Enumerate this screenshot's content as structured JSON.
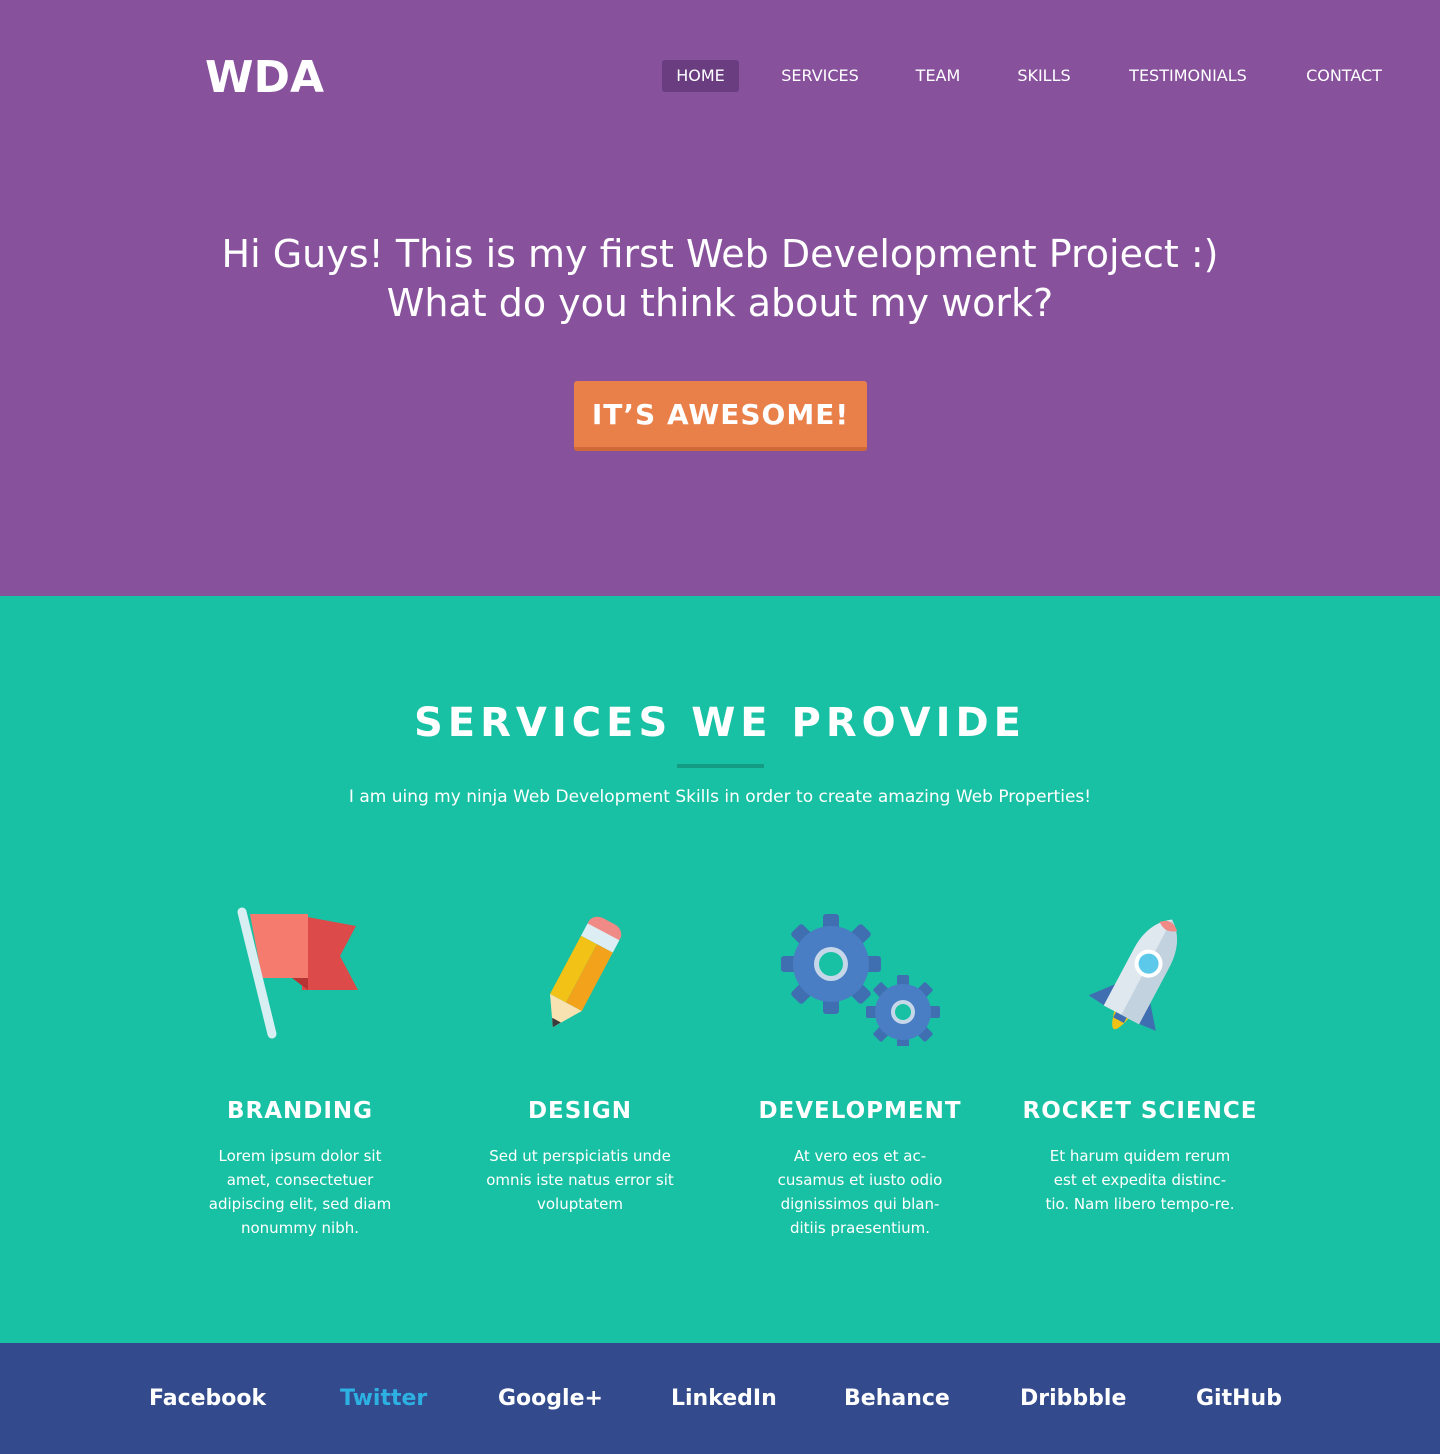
{
  "header": {
    "logo": "WDA",
    "nav": [
      {
        "label": "HOME",
        "active": true
      },
      {
        "label": "SERVICES",
        "active": false
      },
      {
        "label": "TEAM",
        "active": false
      },
      {
        "label": "SKILLS",
        "active": false
      },
      {
        "label": "TESTIMONIALS",
        "active": false
      },
      {
        "label": "CONTACT",
        "active": false
      }
    ]
  },
  "hero": {
    "line1": "Hi Guys! This is my first Web Development Project :)",
    "line2": "What do you think about my work?",
    "cta": "IT’S AWESOME!"
  },
  "services": {
    "title": "SERVICES WE PROVIDE",
    "subtitle": "I am uing my ninja Web Development Skills in order to create amazing Web Properties!",
    "items": [
      {
        "icon": "flag-icon",
        "name": "BRANDING",
        "desc": "Lorem ipsum dolor sit amet, consectetuer adipiscing elit, sed diam nonummy nibh."
      },
      {
        "icon": "pencil-icon",
        "name": "DESIGN",
        "desc": "Sed ut perspiciatis unde omnis iste natus error sit voluptatem"
      },
      {
        "icon": "gears-icon",
        "name": "DEVELOPMENT",
        "desc": "At vero eos et ac-cusamus et iusto odio dignissimos qui blan-ditiis praesentium."
      },
      {
        "icon": "rocket-icon",
        "name": "ROCKET SCIENCE",
        "desc": "Et harum quidem rerum est et expedita distinc-tio. Nam libero tempo-re."
      }
    ]
  },
  "footer": {
    "links": [
      {
        "label": "Facebook",
        "highlight": false
      },
      {
        "label": "Twitter",
        "highlight": true
      },
      {
        "label": "Google+",
        "highlight": false
      },
      {
        "label": "LinkedIn",
        "highlight": false
      },
      {
        "label": "Behance",
        "highlight": false
      },
      {
        "label": "Dribbble",
        "highlight": false
      },
      {
        "label": "GitHub",
        "highlight": false
      }
    ]
  },
  "colors": {
    "hero_bg": "#87519c",
    "nav_active_bg": "#693d7f",
    "cta_bg": "#e9804a",
    "services_bg": "#18c1a3",
    "footer_bg": "#334b8c",
    "footer_highlight": "#2db0e2"
  }
}
